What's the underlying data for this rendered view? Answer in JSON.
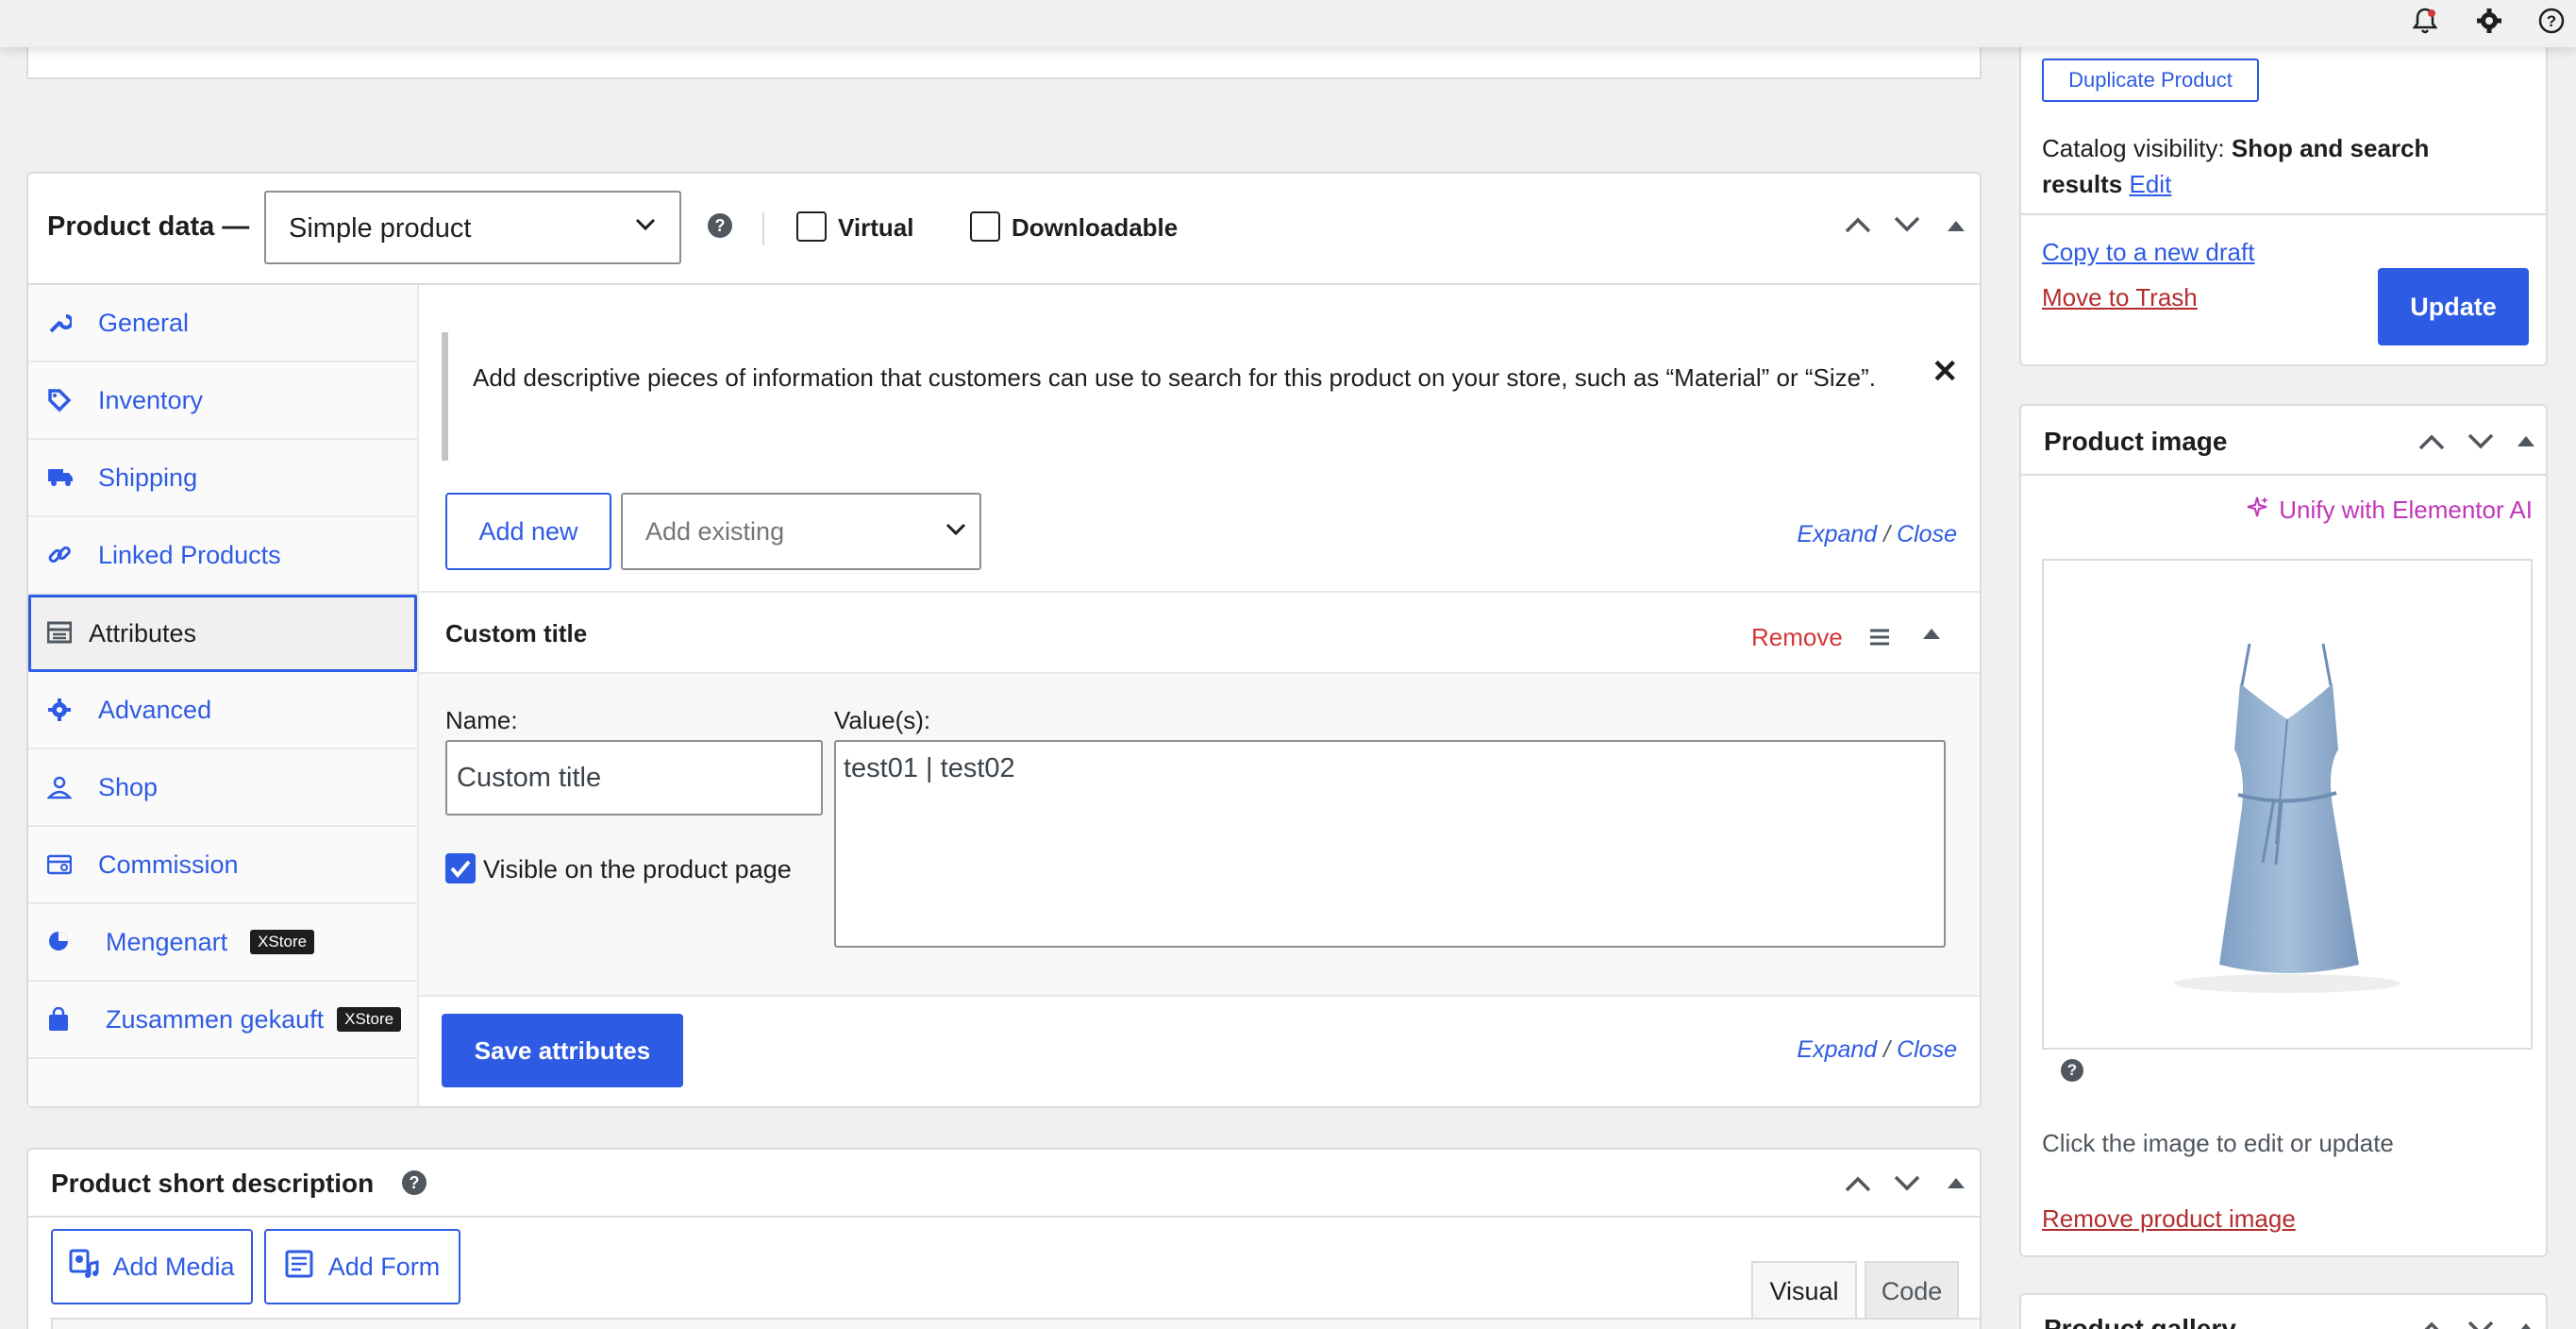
{
  "topbar": {
    "icons": [
      "bell-icon",
      "gear-icon",
      "help-icon"
    ]
  },
  "product_data": {
    "title": "Product data —",
    "product_type": "Simple product",
    "virtual_label": "Virtual",
    "downloadable_label": "Downloadable",
    "tabs": [
      {
        "label": "General",
        "icon": "wrench-icon"
      },
      {
        "label": "Inventory",
        "icon": "tag-icon"
      },
      {
        "label": "Shipping",
        "icon": "truck-icon"
      },
      {
        "label": "Linked Products",
        "icon": "link-icon"
      },
      {
        "label": "Attributes",
        "icon": "table-icon"
      },
      {
        "label": "Advanced",
        "icon": "gear-icon"
      },
      {
        "label": "Shop",
        "icon": "user-icon"
      },
      {
        "label": "Commission",
        "icon": "card-icon"
      },
      {
        "label": "Mengenart",
        "icon": "pie-icon",
        "badge": "XStore"
      },
      {
        "label": "Zusammen gekauft",
        "icon": "bag-icon",
        "badge": "XStore"
      }
    ],
    "notice": "Add descriptive pieces of information that customers can use to search for this product on your store, such as “Material” or “Size”.",
    "add_new_label": "Add new",
    "add_existing_placeholder": "Add existing",
    "expand_label": "Expand",
    "slash": "/",
    "close_label": "Close",
    "attribute": {
      "title": "Custom title",
      "remove_label": "Remove",
      "name_label": "Name:",
      "name_value": "Custom title",
      "values_label": "Value(s):",
      "values_value": "test01 | test02",
      "visible_label": "Visible on the product page",
      "visible_checked": true
    },
    "save_label": "Save attributes"
  },
  "short_description": {
    "title": "Product short description",
    "add_media_label": "Add Media",
    "add_form_label": "Add Form",
    "visual_tab": "Visual",
    "code_tab": "Code"
  },
  "publish": {
    "duplicate_label": "Duplicate Product",
    "catalog_visibility_label": "Catalog visibility:",
    "catalog_visibility_value": "Shop and search results",
    "edit_label": "Edit",
    "copy_draft_label": "Copy to a new draft",
    "trash_label": "Move to Trash",
    "update_label": "Update"
  },
  "product_image": {
    "title": "Product image",
    "elementor_label": "Unify with Elementor AI",
    "hint": "Click the image to edit or update",
    "remove_label": "Remove product image"
  },
  "product_gallery": {
    "title": "Product gallery"
  },
  "colors": {
    "accent": "#2e5be3",
    "danger": "#b32d2e",
    "elementor": "#c036b8"
  }
}
